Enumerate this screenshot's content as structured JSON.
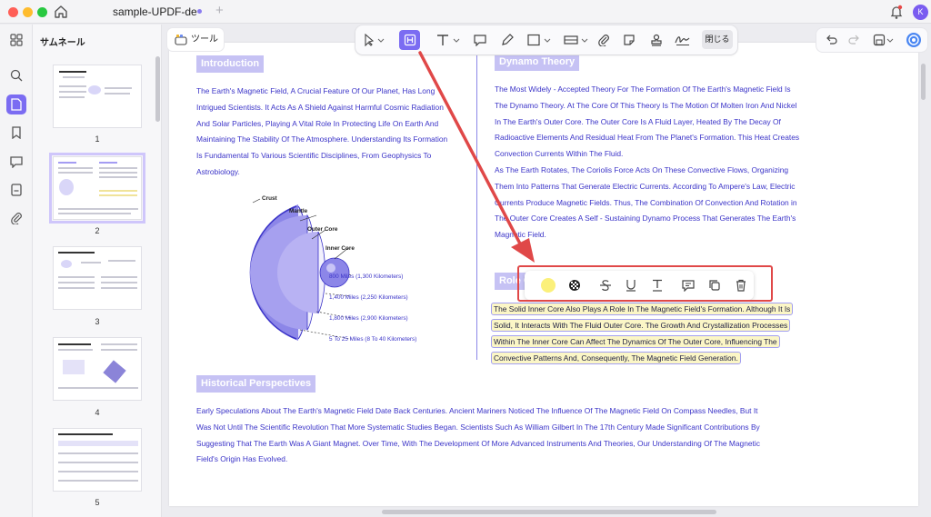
{
  "titlebar": {
    "doc_tab": "sample-UPDF-de",
    "new_tab": "+",
    "avatar_initial": "K",
    "traffic_colors": [
      "#ff5f57",
      "#febc2e",
      "#28c840"
    ]
  },
  "thumbnails": {
    "title": "サムネール",
    "pages": [
      {
        "num": "1"
      },
      {
        "num": "2"
      },
      {
        "num": "3"
      },
      {
        "num": "4"
      },
      {
        "num": "5"
      }
    ]
  },
  "toolbar": {
    "tools_label": "ツール",
    "close_label": "閉じる",
    "accent_color": "#7b6cf2"
  },
  "page": {
    "introduction": {
      "heading": "Introduction",
      "lines": [
        "The Earth's Magnetic Field, A Crucial Feature Of Our Planet, Has Long",
        "Intrigued Scientists. It Acts As A Shield Against Harmful Cosmic Radiation",
        "And Solar Particles, Playing A Vital Role In Protecting Life On Earth And",
        "Maintaining The Stability Of The Atmosphere. Understanding Its Formation",
        "Is Fundamental To Various Scientific Disciplines, From Geophysics To",
        "Astrobiology."
      ]
    },
    "diagram": {
      "labels": [
        "Crust",
        "Mantle",
        "Outer Core",
        "Inner Core"
      ],
      "miles": [
        "800 Miles (1,300 Kilometers)",
        "1,400 Miles (2,250 Kilometers)",
        "1,800 Miles (2,900 Kilometers)",
        "5 To 25 Miles (8 To 40 Kilometers)"
      ]
    },
    "dynamo": {
      "heading": "Dynamo Theory",
      "lines": [
        "The Most Widely - Accepted Theory For The Formation Of The Earth's Magnetic Field Is",
        "The Dynamo Theory. At The Core Of This Theory Is The Motion Of Molten Iron And Nickel",
        "In The Earth's Outer Core. The Outer Core Is A Fluid Layer, Heated By The Decay Of",
        "Radioactive Elements And Residual Heat From The Planet's Formation. This Heat Creates",
        "Convection Currents Within The Fluid.",
        "As The Earth Rotates, The Coriolis Force Acts On These Convective Flows, Organizing",
        "Them Into Patterns That Generate Electric Currents. According To Ampere's Law, Electric",
        "Currents Produce Magnetic Fields. Thus, The Combination Of Convection And Rotation in",
        "The Outer Core Creates A Self - Sustaining Dynamo Process That Generates The Earth's",
        "Magnetic Field."
      ]
    },
    "role": {
      "heading": "Role Of",
      "highlighted_lines": [
        "The Solid Inner Core Also Plays A Role In The Magnetic Field's Formation. Although It Is",
        "Solid, It Interacts With The Fluid Outer Core. The Growth And Crystallization Processes",
        "Within The Inner Core Can Affect The Dynamics Of The Outer Core, Influencing The",
        "Convective Patterns And, Consequently, The Magnetic Field Generation."
      ],
      "highlight_color": "#fbf6c6"
    },
    "historical": {
      "heading": "Historical Perspectives",
      "lines": [
        "Early Speculations About The Earth's Magnetic Field Date Back Centuries. Ancient Mariners Noticed The Influence Of The Magnetic Field On Compass Needles, But It",
        "Was Not Until The Scientific Revolution That More Systematic Studies Began. Scientists Such As William Gilbert In The 17th Century Made Significant Contributions By",
        "Suggesting That The Earth Was A Giant Magnet. Over Time, With The Development Of More Advanced Instruments And Theories, Our Understanding Of The Magnetic",
        "Field's Origin Has Evolved."
      ]
    }
  },
  "popup": {
    "highlight_swatch_color": "#fbf07a",
    "frame_color": "#e04848"
  }
}
